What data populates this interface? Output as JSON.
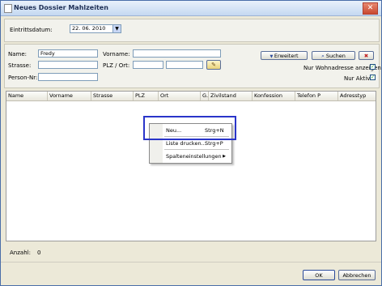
{
  "window": {
    "title": "Neues Dossier Mahlzeiten",
    "close_label": "✕"
  },
  "top": {
    "eintritt_label": "Eintrittsdatum:",
    "eintritt_value": "22. 06. 2010"
  },
  "search": {
    "name_label": "Name:",
    "name_value": "Fredy",
    "vorname_label": "Vorname:",
    "vorname_value": "",
    "strasse_label": "Strasse:",
    "strasse_value": "",
    "plz_ort_label": "PLZ / Ort:",
    "plz_value": "",
    "ort_value": "",
    "person_nr_label": "Person-Nr:",
    "person_nr_value": "",
    "erweitert_label": "Erweitert",
    "suchen_label": "Suchen",
    "wohnadresse_label": "Nur Wohnadresse anzeigen",
    "wohnadresse_checked": true,
    "aktive_label": "Nur Aktive",
    "aktive_checked": true
  },
  "grid": {
    "columns": [
      "Name",
      "Vorname",
      "Strasse",
      "PLZ",
      "Ort",
      "G.",
      "Zivilstand",
      "Konfession",
      "Telefon P",
      "Adresstyp"
    ]
  },
  "context_menu": {
    "items": [
      {
        "label": "Neu...",
        "shortcut": "Strg+N"
      },
      {
        "label": "Liste drucken...",
        "shortcut": "Strg+P"
      },
      {
        "label": "Spalteneinstellungen",
        "shortcut": ""
      }
    ]
  },
  "status": {
    "anzahl_label": "Anzahl:",
    "anzahl_value": "0"
  },
  "footer": {
    "ok_label": "OK",
    "abbrechen_label": "Abbrechen"
  },
  "colors": {
    "highlight": "#2a35c9",
    "title_bar": "#c4d8f1",
    "dialog_bg": "#ece9d8"
  }
}
